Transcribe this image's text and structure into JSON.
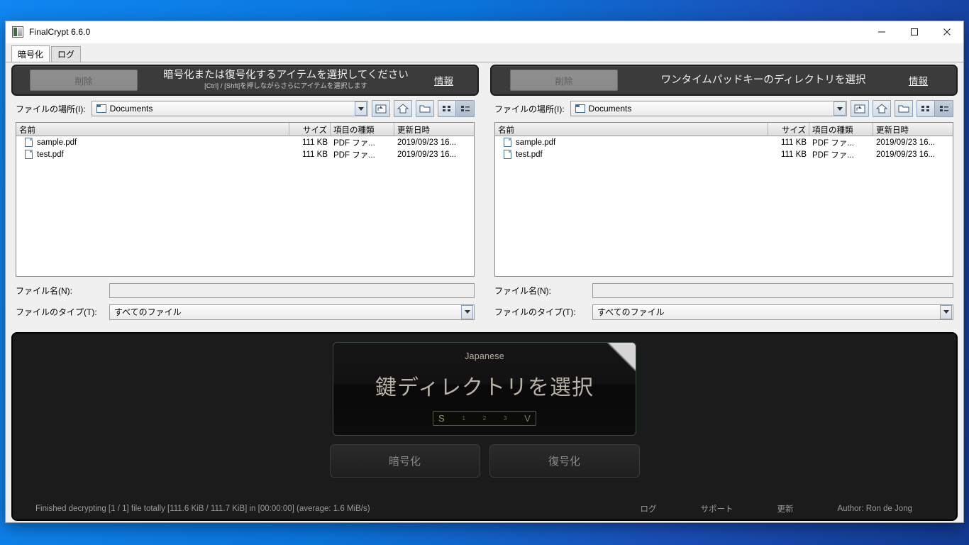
{
  "window": {
    "title": "FinalCrypt 6.6.0",
    "icon": "app-icon",
    "controls": {
      "minimize": "—",
      "maximize": "□",
      "close": "✕"
    }
  },
  "tabs": [
    {
      "label": "暗号化",
      "active": true
    },
    {
      "label": "ログ",
      "active": false
    }
  ],
  "left_pane": {
    "header": {
      "delete_label": "削除",
      "title": "暗号化または復号化するアイテムを選択してください",
      "subtitle": "[Ctrl] / [Shft]を押しながらさらにアイテムを選択します",
      "info_label": "情報"
    },
    "chooser": {
      "look_in_label": "ファイルの場所(I):",
      "look_in_value": "Documents",
      "columns": [
        "名前",
        "サイズ",
        "項目の種類",
        "更新日時"
      ],
      "files": [
        {
          "name": "sample.pdf",
          "size": "111 KB",
          "type": "PDF ファ...",
          "date": "2019/09/23 16..."
        },
        {
          "name": "test.pdf",
          "size": "111 KB",
          "type": "PDF ファ...",
          "date": "2019/09/23 16..."
        }
      ],
      "filename_label": "ファイル名(N):",
      "filename_value": "",
      "filetype_label": "ファイルのタイプ(T):",
      "filetype_value": "すべてのファイル"
    }
  },
  "right_pane": {
    "header": {
      "delete_label": "削除",
      "title": "ワンタイムパッドキーのディレクトリを選択",
      "subtitle": "",
      "info_label": "情報"
    },
    "chooser": {
      "look_in_label": "ファイルの場所(I):",
      "look_in_value": "Documents",
      "columns": [
        "名前",
        "サイズ",
        "項目の種類",
        "更新日時"
      ],
      "files": [
        {
          "name": "sample.pdf",
          "size": "111 KB",
          "type": "PDF ファ...",
          "date": "2019/09/23 16..."
        },
        {
          "name": "test.pdf",
          "size": "111 KB",
          "type": "PDF ファ...",
          "date": "2019/09/23 16..."
        }
      ],
      "filename_label": "ファイル名(N):",
      "filename_value": "",
      "filetype_label": "ファイルのタイプ(T):",
      "filetype_value": "すべてのファイル"
    }
  },
  "center_panel": {
    "language": "Japanese",
    "title": "鍵ディレクトリを選択",
    "meter": {
      "start": "S",
      "ticks": [
        "1",
        "2",
        "3"
      ],
      "end": "V"
    }
  },
  "actions": {
    "encrypt_label": "暗号化",
    "decrypt_label": "復号化"
  },
  "status": {
    "text": "Finished decrypting [1 / 1] file totally [111.6 KiB / 111.7 KiB] in [00:00:00] (average: 1.6 MiB/s)",
    "links": [
      "ログ",
      "サポート",
      "更新"
    ],
    "author": "Author: Ron de Jong"
  },
  "colors": {
    "desktop_blue": "#0a74da",
    "dark_panel": "#1b1b1b",
    "dark_header": "#3b3b3b",
    "accent_text": "#b9b2a7",
    "meter_green": "#8f9b52"
  }
}
